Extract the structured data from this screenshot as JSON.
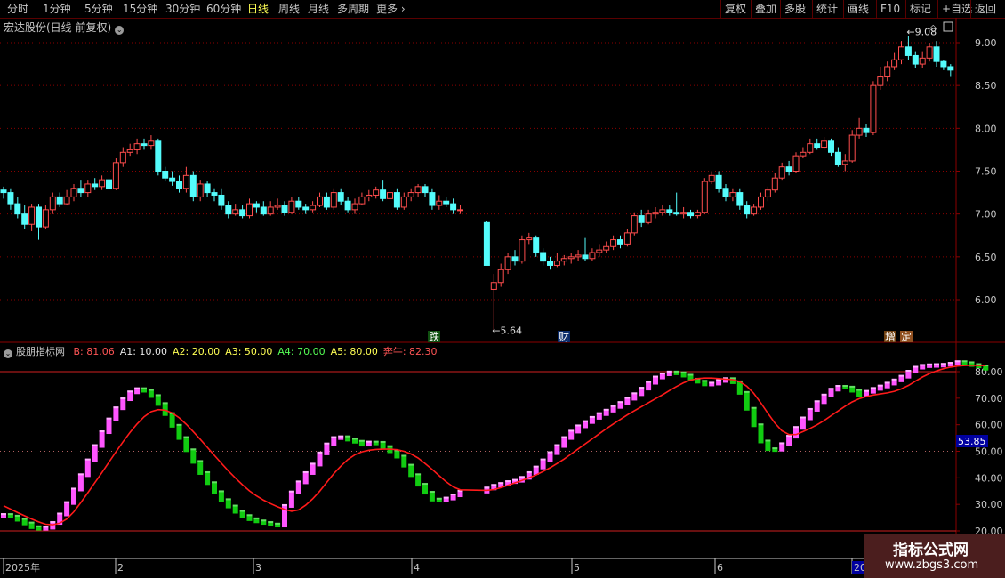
{
  "toolbar": {
    "left": [
      "分时",
      "1分钟",
      "5分钟",
      "15分钟",
      "30分钟",
      "60分钟",
      "日线",
      "周线",
      "月线",
      "多周期",
      "更多"
    ],
    "active": "日线",
    "right": [
      "复权",
      "叠加",
      "多股",
      "统计",
      "画线",
      "F10",
      "标记",
      "+自选",
      "返回"
    ]
  },
  "main_title": "宏达股份(日线 前复权)",
  "indicator": {
    "name": "股朋指标网",
    "params": [
      {
        "label": "B:",
        "value": "81.06",
        "color": "#ff5555"
      },
      {
        "label": "A1:",
        "value": "10.00",
        "color": "#e8e8e8"
      },
      {
        "label": "A2:",
        "value": "20.00",
        "color": "#ffff54"
      },
      {
        "label": "A3:",
        "value": "50.00",
        "color": "#ffff54"
      },
      {
        "label": "A4:",
        "value": "70.00",
        "color": "#55ff55"
      },
      {
        "label": "A5:",
        "value": "80.00",
        "color": "#ffff54"
      },
      {
        "label": "奔牛:",
        "value": "82.30",
        "color": "#ff5555"
      }
    ],
    "current_value": "53.85"
  },
  "price_axis": [
    "9.00",
    "8.50",
    "8.00",
    "7.50",
    "7.00",
    "6.50",
    "6.00"
  ],
  "indicator_axis": [
    "80.00",
    "70.00",
    "60.00",
    "50.00",
    "40.00",
    "30.00",
    "20.00"
  ],
  "x_axis": [
    "2025年",
    "2",
    "3",
    "4",
    "5",
    "6",
    "20"
  ],
  "annotations": {
    "high_label": "9.08",
    "low_label": "5.64",
    "tags": [
      {
        "text": "跌",
        "bg": "#105010",
        "fg": "#ffffff"
      },
      {
        "text": "财",
        "bg": "#0a2a6a",
        "fg": "#ffffff"
      },
      {
        "text": "增",
        "bg": "#704010",
        "fg": "#ffffff"
      },
      {
        "text": "定",
        "bg": "#905020",
        "fg": "#ffffff"
      }
    ]
  },
  "watermark": {
    "title": "指标公式网",
    "url": "www.zbgs3.com"
  },
  "colors": {
    "up": "#ff4d4d",
    "down": "#54fcfc",
    "signal": "#ff1a1a",
    "rising": "#ff55ff",
    "falling": "#11cc11",
    "grid": "#8b0000"
  },
  "chart_data": [
    {
      "type": "candlestick",
      "title": "宏达股份(日线 前复权)",
      "ylim": [
        5.45,
        9.3
      ],
      "candles": [
        [
          7.28,
          7.25,
          7.32,
          7.18
        ],
        [
          7.25,
          7.12,
          7.3,
          7.05
        ],
        [
          7.12,
          7.0,
          7.2,
          6.95
        ],
        [
          7.0,
          6.88,
          7.1,
          6.82
        ],
        [
          6.88,
          7.08,
          7.12,
          6.8
        ],
        [
          7.08,
          6.85,
          7.12,
          6.7
        ],
        [
          6.85,
          7.05,
          7.1,
          6.83
        ],
        [
          7.05,
          7.2,
          7.25,
          7.0
        ],
        [
          7.2,
          7.12,
          7.25,
          7.08
        ],
        [
          7.12,
          7.2,
          7.28,
          7.1
        ],
        [
          7.2,
          7.3,
          7.35,
          7.15
        ],
        [
          7.3,
          7.25,
          7.4,
          7.2
        ],
        [
          7.25,
          7.35,
          7.4,
          7.2
        ],
        [
          7.35,
          7.32,
          7.42,
          7.28
        ],
        [
          7.32,
          7.4,
          7.45,
          7.28
        ],
        [
          7.4,
          7.3,
          7.45,
          7.25
        ],
        [
          7.3,
          7.6,
          7.65,
          7.28
        ],
        [
          7.6,
          7.72,
          7.78,
          7.55
        ],
        [
          7.72,
          7.75,
          7.82,
          7.68
        ],
        [
          7.75,
          7.82,
          7.88,
          7.7
        ],
        [
          7.82,
          7.8,
          7.88,
          7.75
        ],
        [
          7.8,
          7.85,
          7.92,
          7.75
        ],
        [
          7.85,
          7.5,
          7.88,
          7.45
        ],
        [
          7.5,
          7.42,
          7.55,
          7.38
        ],
        [
          7.42,
          7.38,
          7.5,
          7.33
        ],
        [
          7.38,
          7.3,
          7.45,
          7.25
        ],
        [
          7.3,
          7.45,
          7.55,
          7.25
        ],
        [
          7.45,
          7.2,
          7.5,
          7.15
        ],
        [
          7.2,
          7.35,
          7.4,
          7.15
        ],
        [
          7.35,
          7.25,
          7.38,
          7.2
        ],
        [
          7.25,
          7.22,
          7.3,
          7.15
        ],
        [
          7.22,
          7.1,
          7.3,
          7.05
        ],
        [
          7.1,
          7.0,
          7.15,
          6.95
        ],
        [
          7.0,
          7.05,
          7.12,
          6.98
        ],
        [
          7.05,
          6.98,
          7.1,
          6.95
        ],
        [
          6.98,
          7.12,
          7.18,
          6.95
        ],
        [
          7.12,
          7.08,
          7.15,
          7.02
        ],
        [
          7.08,
          7.0,
          7.15,
          6.98
        ],
        [
          7.0,
          7.08,
          7.15,
          6.98
        ],
        [
          7.08,
          7.1,
          7.18,
          7.05
        ],
        [
          7.1,
          7.02,
          7.15,
          6.98
        ],
        [
          7.02,
          7.15,
          7.2,
          7.0
        ],
        [
          7.15,
          7.08,
          7.2,
          7.05
        ],
        [
          7.08,
          7.05,
          7.12,
          7.0
        ],
        [
          7.05,
          7.1,
          7.15,
          7.02
        ],
        [
          7.1,
          7.2,
          7.25,
          7.08
        ],
        [
          7.2,
          7.08,
          7.25,
          7.05
        ],
        [
          7.08,
          7.25,
          7.3,
          7.05
        ],
        [
          7.25,
          7.15,
          7.3,
          7.1
        ],
        [
          7.15,
          7.05,
          7.2,
          7.02
        ],
        [
          7.05,
          7.12,
          7.18,
          7.0
        ],
        [
          7.12,
          7.2,
          7.25,
          7.1
        ],
        [
          7.2,
          7.22,
          7.28,
          7.15
        ],
        [
          7.22,
          7.28,
          7.32,
          7.18
        ],
        [
          7.28,
          7.18,
          7.4,
          7.15
        ],
        [
          7.18,
          7.25,
          7.3,
          7.12
        ],
        [
          7.25,
          7.08,
          7.3,
          7.05
        ],
        [
          7.08,
          7.2,
          7.25,
          7.05
        ],
        [
          7.2,
          7.25,
          7.3,
          7.15
        ],
        [
          7.25,
          7.32,
          7.35,
          7.2
        ],
        [
          7.32,
          7.25,
          7.35,
          7.2
        ],
        [
          7.25,
          7.1,
          7.3,
          7.05
        ],
        [
          7.1,
          7.15,
          7.22,
          7.05
        ],
        [
          7.15,
          7.12,
          7.2,
          7.08
        ],
        [
          7.12,
          7.05,
          7.18,
          7.0
        ],
        [
          7.05,
          7.05,
          7.1,
          7.0
        ],
        [
          6.9,
          6.4,
          6.92,
          6.4
        ],
        [
          6.12,
          6.2,
          6.3,
          5.64
        ],
        [
          6.2,
          6.35,
          6.42,
          6.15
        ],
        [
          6.35,
          6.5,
          6.55,
          6.3
        ],
        [
          6.5,
          6.45,
          6.58,
          6.4
        ],
        [
          6.45,
          6.7,
          6.75,
          6.42
        ],
        [
          6.7,
          6.72,
          6.78,
          6.65
        ],
        [
          6.72,
          6.55,
          6.75,
          6.5
        ],
        [
          6.55,
          6.45,
          6.6,
          6.4
        ],
        [
          6.45,
          6.4,
          6.5,
          6.35
        ],
        [
          6.4,
          6.45,
          6.55,
          6.38
        ],
        [
          6.45,
          6.48,
          6.52,
          6.4
        ],
        [
          6.48,
          6.5,
          6.55,
          6.42
        ],
        [
          6.5,
          6.52,
          6.58,
          6.45
        ],
        [
          6.52,
          6.48,
          6.72,
          6.45
        ],
        [
          6.48,
          6.55,
          6.6,
          6.45
        ],
        [
          6.55,
          6.58,
          6.65,
          6.5
        ],
        [
          6.58,
          6.62,
          6.68,
          6.55
        ],
        [
          6.62,
          6.7,
          6.75,
          6.58
        ],
        [
          6.7,
          6.65,
          6.75,
          6.6
        ],
        [
          6.65,
          6.78,
          6.82,
          6.62
        ],
        [
          6.78,
          6.98,
          7.02,
          6.75
        ],
        [
          6.98,
          6.9,
          7.05,
          6.85
        ],
        [
          6.9,
          7.0,
          7.05,
          6.88
        ],
        [
          7.0,
          7.02,
          7.08,
          6.95
        ],
        [
          7.02,
          7.05,
          7.1,
          6.98
        ],
        [
          7.05,
          7.02,
          7.1,
          6.98
        ],
        [
          7.02,
          7.0,
          7.25,
          6.98
        ],
        [
          7.0,
          7.02,
          7.08,
          6.95
        ],
        [
          7.02,
          6.98,
          7.05,
          6.95
        ],
        [
          6.98,
          7.02,
          7.05,
          6.95
        ],
        [
          7.02,
          7.38,
          7.42,
          7.0
        ],
        [
          7.38,
          7.45,
          7.5,
          7.35
        ],
        [
          7.45,
          7.3,
          7.5,
          7.25
        ],
        [
          7.3,
          7.2,
          7.35,
          7.15
        ],
        [
          7.2,
          7.25,
          7.3,
          7.15
        ],
        [
          7.25,
          7.1,
          7.3,
          7.05
        ],
        [
          7.1,
          7.0,
          7.15,
          6.95
        ],
        [
          7.0,
          7.08,
          7.12,
          6.98
        ],
        [
          7.08,
          7.2,
          7.25,
          7.05
        ],
        [
          7.2,
          7.28,
          7.32,
          7.15
        ],
        [
          7.28,
          7.42,
          7.48,
          7.25
        ],
        [
          7.42,
          7.55,
          7.6,
          7.4
        ],
        [
          7.55,
          7.5,
          7.62,
          7.45
        ],
        [
          7.5,
          7.68,
          7.72,
          7.48
        ],
        [
          7.68,
          7.72,
          7.78,
          7.65
        ],
        [
          7.72,
          7.82,
          7.88,
          7.7
        ],
        [
          7.82,
          7.78,
          7.88,
          7.75
        ],
        [
          7.78,
          7.85,
          7.9,
          7.75
        ],
        [
          7.85,
          7.72,
          7.88,
          7.68
        ],
        [
          7.72,
          7.58,
          7.78,
          7.55
        ],
        [
          7.58,
          7.62,
          7.7,
          7.5
        ],
        [
          7.62,
          7.92,
          7.98,
          7.6
        ],
        [
          7.92,
          8.0,
          8.12,
          7.88
        ],
        [
          8.0,
          7.95,
          8.05,
          7.9
        ],
        [
          7.95,
          8.5,
          8.55,
          7.92
        ],
        [
          8.5,
          8.6,
          8.72,
          8.45
        ],
        [
          8.6,
          8.72,
          8.78,
          8.55
        ],
        [
          8.72,
          8.8,
          8.88,
          8.68
        ],
        [
          8.8,
          8.95,
          9.02,
          8.75
        ],
        [
          8.95,
          8.85,
          9.08,
          8.8
        ],
        [
          8.85,
          8.75,
          8.9,
          8.7
        ],
        [
          8.75,
          8.82,
          8.9,
          8.7
        ],
        [
          8.82,
          8.95,
          9.0,
          8.78
        ],
        [
          8.95,
          8.78,
          9.02,
          8.72
        ],
        [
          8.78,
          8.72,
          8.8,
          8.68
        ],
        [
          8.72,
          8.68,
          8.75,
          8.6
        ]
      ],
      "suspension_after_index": 65
    },
    {
      "type": "line",
      "title": "股朋指标网",
      "ylim": [
        17,
        85
      ],
      "ticks": [
        80,
        70,
        60,
        50,
        40,
        30,
        20
      ],
      "reference_lines": [
        80,
        50,
        20
      ],
      "series": [
        {
          "name": "B",
          "values": [
            26.0,
            25.4,
            24.2,
            22.8,
            21.4,
            20.8,
            21.2,
            23.0,
            26.2,
            30.5,
            35.6,
            41.0,
            46.6,
            52.0,
            57.2,
            62.0,
            66.2,
            69.6,
            72.2,
            73.4,
            72.8,
            70.8,
            67.8,
            64.0,
            59.6,
            55.0,
            50.4,
            46.0,
            41.8,
            38.0,
            34.6,
            31.6,
            29.2,
            27.2,
            25.6,
            24.4,
            23.6,
            23.0,
            22.4,
            22.0,
            29.4,
            34.5,
            38.3,
            41.8,
            45.0,
            49.2,
            52.6,
            55.0,
            55.3,
            54.4,
            53.6,
            52.5,
            53.3,
            53.2,
            51.6,
            50.0,
            48.0,
            44.6,
            41.0,
            37.4,
            34.4,
            31.8,
            31.4,
            32.2,
            33.4,
            34.8,
            36.0,
            37.0,
            37.7,
            38.4,
            38.9,
            40.0,
            41.8,
            43.9,
            46.6,
            49.3,
            52.0,
            55.0,
            57.4,
            59.4,
            61.0,
            62.6,
            64.0,
            65.3,
            66.7,
            68.2,
            69.8,
            71.5,
            73.6,
            75.8,
            77.8,
            79.0,
            79.7,
            79.4,
            78.5,
            77.0,
            76.2,
            75.2,
            75.5,
            76.5,
            77.2,
            76.0,
            72.0,
            66.0,
            59.8,
            53.7,
            50.8,
            50.6,
            52.7,
            55.5,
            58.8,
            62.4,
            65.6,
            68.5,
            71.0,
            73.2,
            74.3,
            74.0,
            72.8,
            71.2,
            72.4,
            73.5,
            74.4,
            75.5,
            76.7,
            78.1,
            80.0,
            81.5,
            82.2,
            82.4,
            82.5,
            82.6,
            83.0,
            83.6,
            83.2,
            82.5,
            82.0,
            81.1
          ]
        },
        {
          "name": "奔牛",
          "values": [
            29.5,
            28.2,
            26.9,
            25.7,
            24.5,
            23.4,
            22.5,
            22.3,
            22.9,
            24.5,
            27.2,
            30.7,
            34.4,
            38.2,
            42.0,
            45.9,
            49.8,
            53.6,
            57.1,
            60.3,
            63.0,
            64.9,
            65.7,
            65.5,
            64.4,
            62.6,
            60.2,
            57.4,
            54.5,
            51.5,
            48.5,
            45.5,
            42.6,
            39.9,
            37.4,
            35.1,
            33.2,
            31.6,
            30.3,
            29.1,
            28.1,
            27.4,
            27.9,
            29.7,
            32.1,
            35.0,
            38.3,
            41.6,
            44.4,
            46.9,
            48.7,
            49.8,
            50.4,
            50.7,
            50.8,
            50.8,
            50.6,
            50.0,
            49.0,
            47.5,
            45.4,
            43.2,
            40.8,
            38.5,
            36.6,
            35.5,
            35.3,
            35.6,
            36.3,
            37.2,
            38.1,
            39.0,
            40.0,
            41.1,
            42.4,
            43.8,
            45.4,
            47.1,
            49.0,
            50.9,
            52.8,
            54.7,
            56.6,
            58.5,
            60.3,
            62.0,
            63.7,
            65.3,
            66.8,
            68.3,
            69.8,
            71.3,
            72.9,
            74.4,
            75.8,
            76.8,
            77.4,
            77.6,
            77.6,
            77.4,
            77.2,
            77.0,
            76.2,
            74.5,
            71.8,
            68.2,
            64.3,
            60.6,
            57.7,
            56.3,
            56.3,
            57.4,
            58.6,
            60.0,
            61.6,
            63.4,
            65.2,
            67.0,
            68.6,
            69.8,
            70.6,
            71.2,
            71.6,
            72.0,
            72.6,
            73.5,
            74.8,
            76.4,
            78.0,
            79.3,
            80.3,
            81.1,
            81.7,
            82.1,
            82.3,
            82.4,
            82.3,
            82.3
          ]
        }
      ]
    }
  ]
}
